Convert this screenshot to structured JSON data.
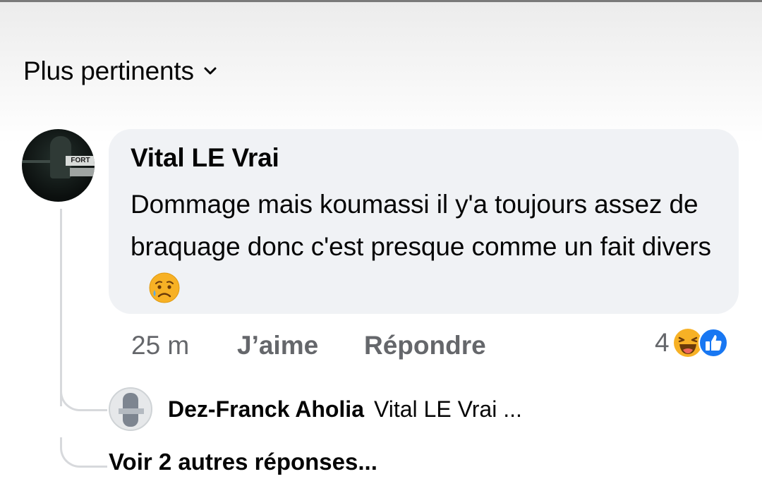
{
  "sort": {
    "label": "Plus pertinents"
  },
  "comment": {
    "author": "Vital LE Vrai",
    "text": "Dommage mais koumassi il y'a toujours assez de braquage donc c'est presque comme un fait divers",
    "emoji": "sad-tear-face",
    "time": "25 m",
    "like_label": "J’aime",
    "reply_label": "Répondre",
    "reaction_count": "4",
    "reactions": [
      "haha",
      "like"
    ],
    "avatar_sign_text": "FORT"
  },
  "reply": {
    "author": "Dez-Franck Aholia",
    "snippet": "Vital LE Vrai ..."
  },
  "more_replies": "Voir 2 autres réponses...",
  "colors": {
    "bubble": "#f0f2f5",
    "secondary_text": "#65676b",
    "like_blue": "#1877f2",
    "emoji_yellow": "#f7b125"
  }
}
